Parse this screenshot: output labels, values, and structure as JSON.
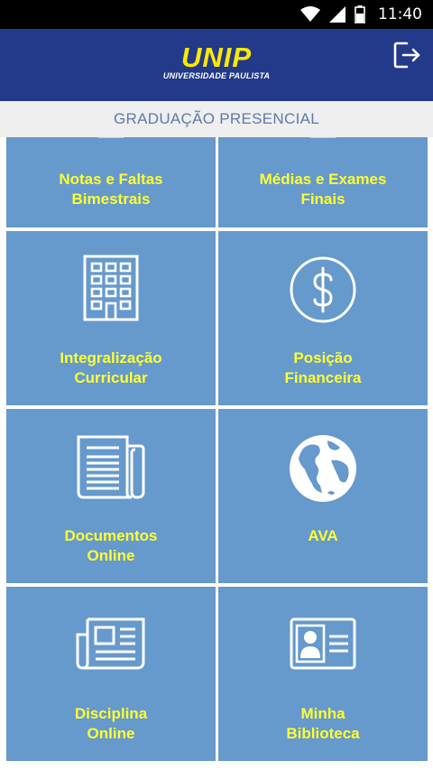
{
  "status_bar": {
    "time": "11:40",
    "icons": [
      "wifi-icon",
      "signal-icon",
      "battery-icon"
    ]
  },
  "header": {
    "logo_main": "UNIP",
    "logo_sub": "UNIVERSIDADE PAULISTA",
    "logout_icon": "logout-icon",
    "bg_color": "#233a8a",
    "logo_color": "#ffe900"
  },
  "section": {
    "title": "GRADUAÇÃO PRESENCIAL"
  },
  "colors": {
    "tile_bg": "#6699cc",
    "tile_text": "#ffff33",
    "icon_stroke": "#ffffff"
  },
  "tiles": [
    {
      "line1": "Notas e Faltas",
      "line2": "Bimestrais",
      "icon": "notes-icon"
    },
    {
      "line1": "Médias e Exames",
      "line2": "Finais",
      "icon": "exams-icon"
    },
    {
      "line1": "Integralização",
      "line2": "Curricular",
      "icon": "building-icon"
    },
    {
      "line1": "Posição",
      "line2": "Financeira",
      "icon": "dollar-icon"
    },
    {
      "line1": "Documentos",
      "line2": "Online",
      "icon": "newspaper-icon"
    },
    {
      "line1": "AVA",
      "line2": "",
      "icon": "globe-icon"
    },
    {
      "line1": "Disciplina",
      "line2": "Online",
      "icon": "news-icon"
    },
    {
      "line1": "Minha",
      "line2": "Biblioteca",
      "icon": "id-card-icon"
    }
  ]
}
